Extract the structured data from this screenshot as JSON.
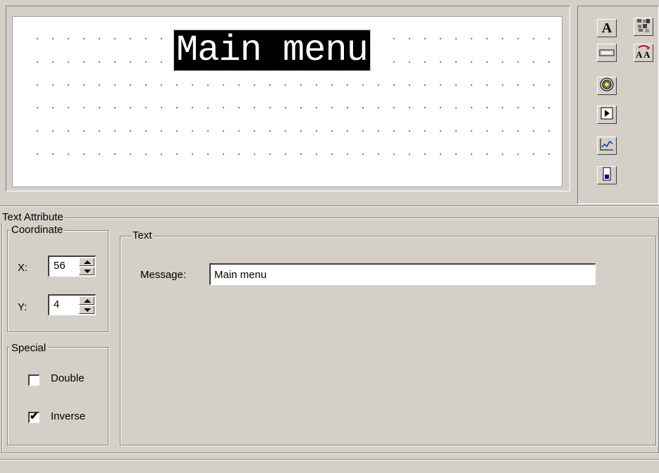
{
  "canvas": {
    "display_text": "Main menu"
  },
  "tools": [
    {
      "name": "text-tool-icon",
      "glyph": "A"
    },
    {
      "name": "bitmap-tool-icon",
      "glyph": "▦"
    },
    {
      "name": "bar-tool-icon",
      "glyph": "▭"
    },
    {
      "name": "font-tool-icon",
      "glyph": "Ä"
    },
    {
      "name": "lamp-tool-icon",
      "glyph": "◎"
    },
    {
      "name": "play-tool-icon",
      "glyph": "▶"
    },
    {
      "name": "trend-tool-icon",
      "glyph": "〰"
    },
    {
      "name": "bargraph-tool-icon",
      "glyph": "▮"
    }
  ],
  "attributes": {
    "title": "Text Attribute",
    "coordinate": {
      "title": "Coordinate",
      "x_label": "X:",
      "x_value": "56",
      "y_label": "Y:",
      "y_value": "4"
    },
    "special": {
      "title": "Special",
      "double_label": "Double",
      "double_checked": false,
      "inverse_label": "Inverse",
      "inverse_checked": true,
      "check_glyph": "✔"
    },
    "text": {
      "title": "Text",
      "message_label": "Message:",
      "message_value": "Main menu"
    }
  }
}
